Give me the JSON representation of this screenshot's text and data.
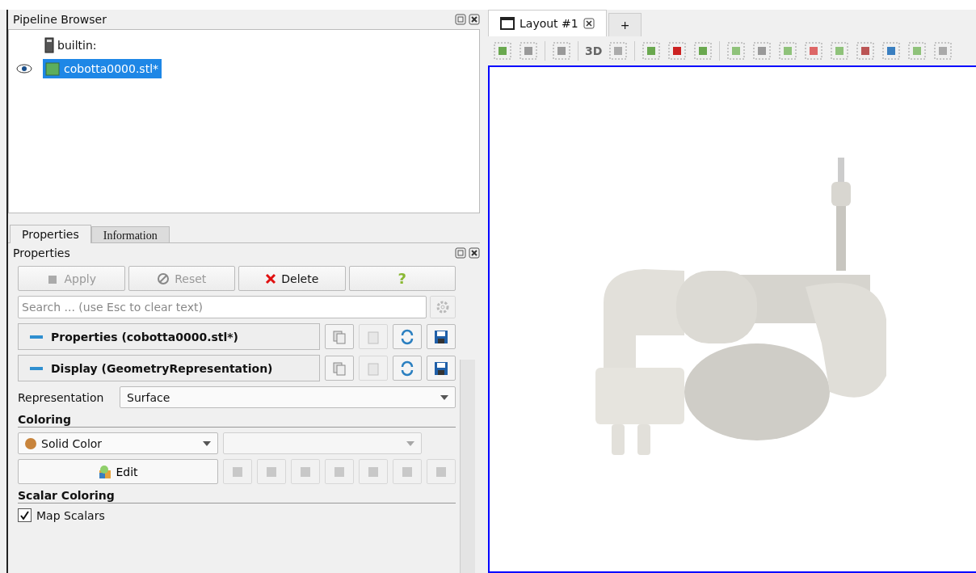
{
  "pipeline_browser": {
    "title": "Pipeline Browser",
    "items": [
      {
        "label": "builtin:",
        "kind": "server",
        "visible": false,
        "selected": false
      },
      {
        "label": "cobotta0000.stl*",
        "kind": "source",
        "visible": true,
        "selected": true
      }
    ]
  },
  "panel_tabs": [
    {
      "label": "Properties",
      "selected": true
    },
    {
      "label": "Information",
      "selected": false
    }
  ],
  "properties": {
    "title": "Properties",
    "buttons": [
      {
        "label": "Apply",
        "kind": "apply",
        "disabled": true
      },
      {
        "label": "Reset",
        "kind": "reset",
        "disabled": true
      },
      {
        "label": "Delete",
        "kind": "delete",
        "disabled": false
      },
      {
        "label": "?",
        "kind": "help",
        "disabled": false
      }
    ],
    "search": {
      "placeholder": "Search ... (use Esc to clear text)"
    },
    "sections": [
      {
        "label": "Properties (cobotta0000.stl*)",
        "expanded": true
      },
      {
        "label": "Display (GeometryRepresentation)",
        "expanded": true
      }
    ],
    "representation": {
      "label": "Representation",
      "value": "Surface"
    },
    "coloring": {
      "heading": "Coloring",
      "value": "Solid Color",
      "color": "#c8843c",
      "edit": "Edit"
    },
    "scalar_coloring": {
      "heading": "Scalar Coloring",
      "map_scalars": {
        "label": "Map Scalars",
        "checked": true
      }
    }
  },
  "layout_tabs": [
    {
      "label": "Layout #1",
      "selected": true
    },
    {
      "label": "+",
      "selected": false
    }
  ],
  "view_toolbar": {
    "mode_label": "3D"
  }
}
